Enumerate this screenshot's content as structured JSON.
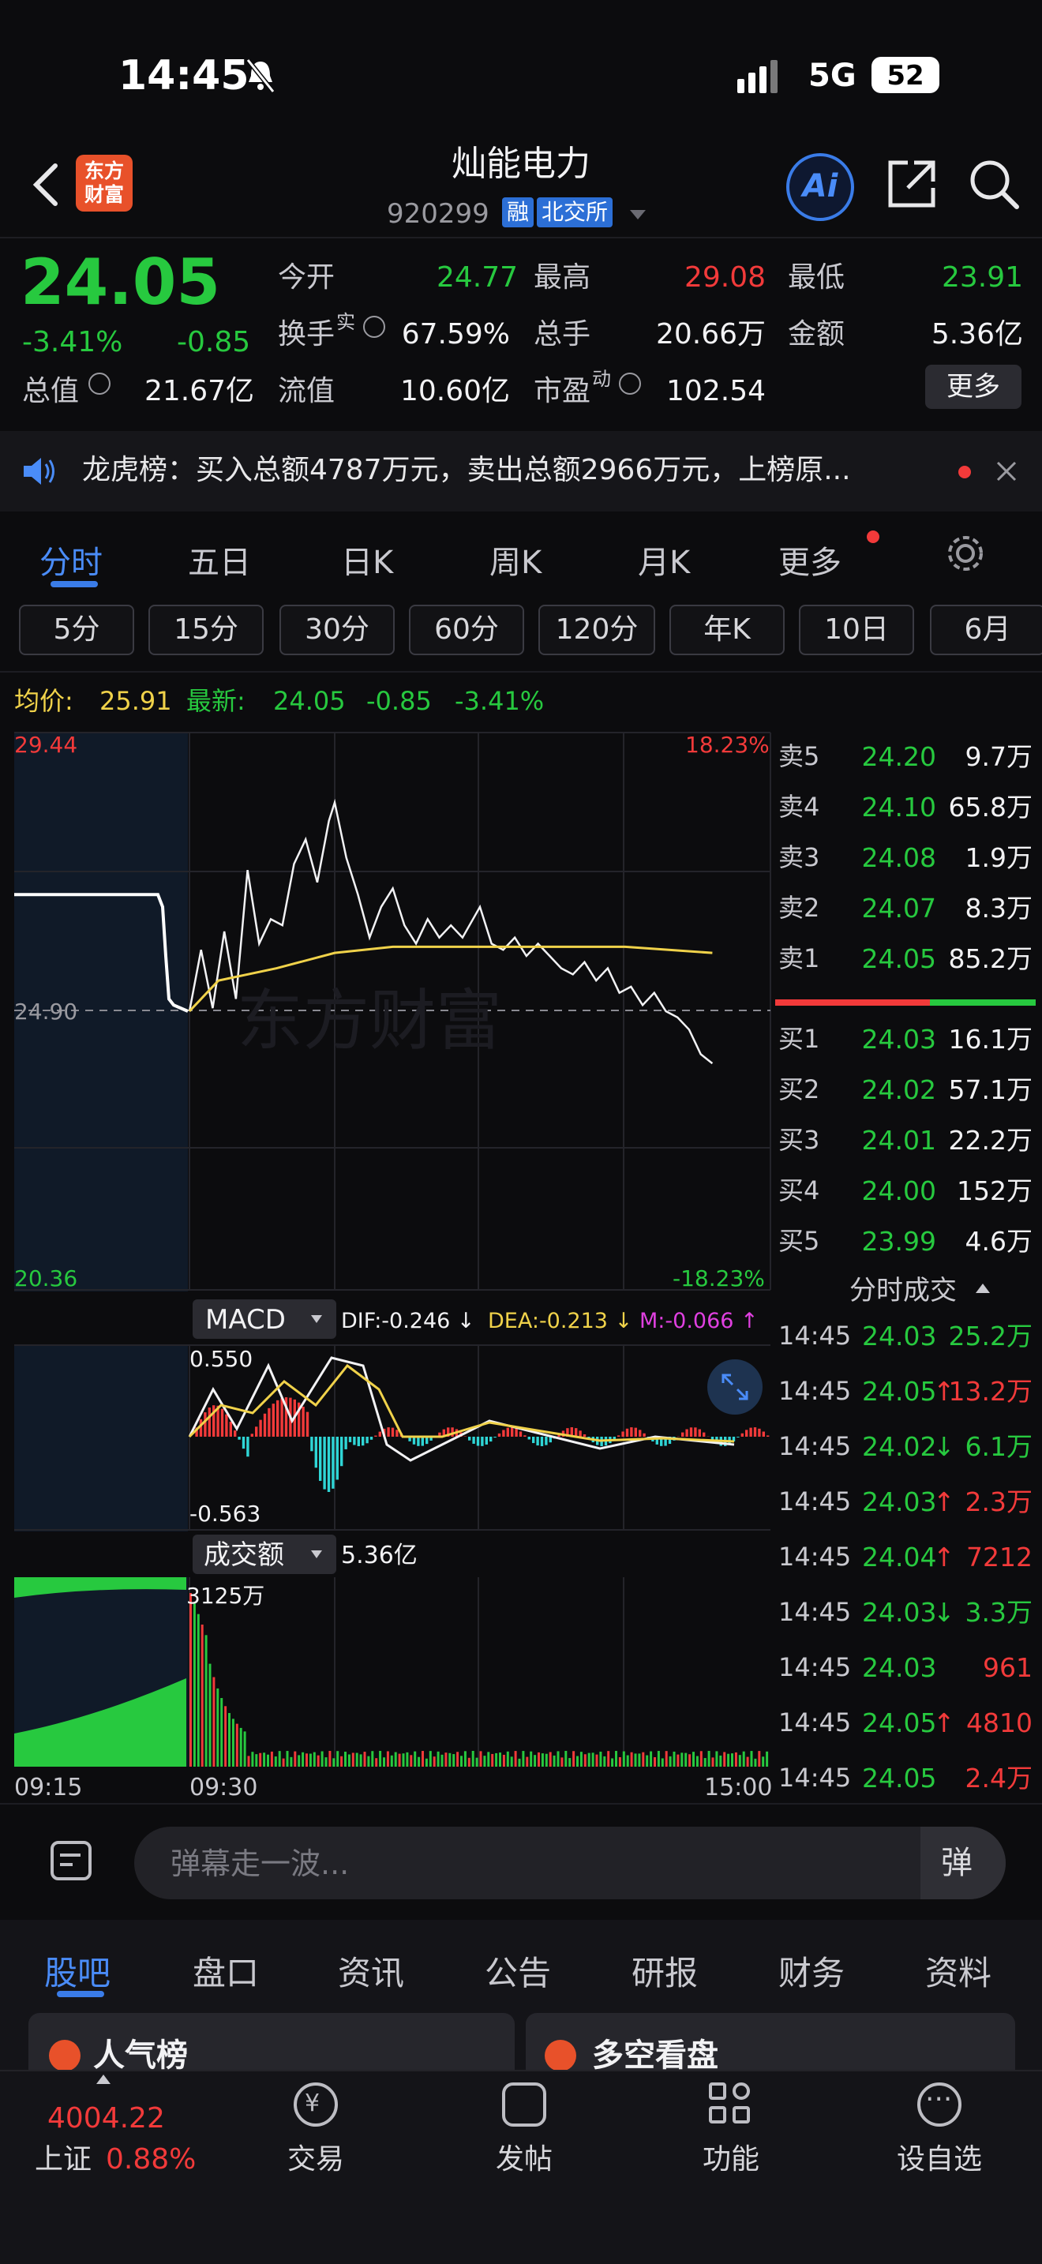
{
  "status": {
    "time": "14:45",
    "network": "5G",
    "battery": "52"
  },
  "header": {
    "title": "灿能电力",
    "code": "920299",
    "tags": [
      "融",
      "北交所"
    ],
    "logo": "东方\n财富",
    "ai_label": "Ai"
  },
  "quote": {
    "price": "24.05",
    "change_pct": "-3.41%",
    "change": "-0.85"
  },
  "stats": {
    "open_label": "今开",
    "open": "24.77",
    "high_label": "最高",
    "high": "29.08",
    "low_label": "最低",
    "low": "23.91",
    "turnover_label": "换手",
    "turnover_sup": "实",
    "turnover": "67.59%",
    "volume_label": "总手",
    "volume": "20.66万",
    "amount_label": "金额",
    "amount": "5.36亿",
    "mktcap_label": "总值",
    "mktcap": "21.67亿",
    "float_label": "流值",
    "float": "10.60亿",
    "pe_label": "市盈",
    "pe_sup": "动",
    "pe": "102.54",
    "more_label": "更多"
  },
  "notice": {
    "text": "龙虎榜：买入总额4787万元，卖出总额2966万元，上榜原..."
  },
  "main_tabs": [
    "分时",
    "五日",
    "日K",
    "周K",
    "月K",
    "更多"
  ],
  "period_buttons": [
    "5分",
    "15分",
    "30分",
    "60分",
    "120分",
    "年K",
    "10日",
    "6月"
  ],
  "info_line": {
    "avg_label": "均价:",
    "avg": "25.91",
    "latest_label": "最新:",
    "latest": "24.05",
    "chg": "-0.85",
    "chg_pct": "-3.41%"
  },
  "intraday": {
    "price_high": "29.44",
    "price_mid": "24.90",
    "price_low": "20.36",
    "pct_high": "18.23%",
    "pct_low": "-18.23%",
    "watermark": "东方财富",
    "prev_close": 24.9,
    "ymax": 29.44,
    "ymin": 20.36
  },
  "order_book": {
    "asks": [
      {
        "label": "卖5",
        "price": "24.20",
        "vol": "9.7万"
      },
      {
        "label": "卖4",
        "price": "24.10",
        "vol": "65.8万"
      },
      {
        "label": "卖3",
        "price": "24.08",
        "vol": "1.9万"
      },
      {
        "label": "卖2",
        "price": "24.07",
        "vol": "8.3万"
      },
      {
        "label": "卖1",
        "price": "24.05",
        "vol": "85.2万"
      }
    ],
    "bids": [
      {
        "label": "买1",
        "price": "24.03",
        "vol": "16.1万"
      },
      {
        "label": "买2",
        "price": "24.02",
        "vol": "57.1万"
      },
      {
        "label": "买3",
        "price": "24.01",
        "vol": "22.2万"
      },
      {
        "label": "买4",
        "price": "24.00",
        "vol": "152万"
      },
      {
        "label": "买5",
        "price": "23.99",
        "vol": "4.6万"
      }
    ]
  },
  "ticks_title": "分时成交",
  "ticks": [
    {
      "time": "14:45",
      "price": "24.03",
      "dir": "",
      "vol": "25.2万",
      "vcolor": "green"
    },
    {
      "time": "14:45",
      "price": "24.05",
      "dir": "↑",
      "vol": "13.2万",
      "vcolor": "red"
    },
    {
      "time": "14:45",
      "price": "24.02",
      "dir": "↓",
      "vol": "6.1万",
      "vcolor": "green"
    },
    {
      "time": "14:45",
      "price": "24.03",
      "dir": "↑",
      "vol": "2.3万",
      "vcolor": "red"
    },
    {
      "time": "14:45",
      "price": "24.04",
      "dir": "↑",
      "vol": "7212",
      "vcolor": "red"
    },
    {
      "time": "14:45",
      "price": "24.03",
      "dir": "↓",
      "vol": "3.3万",
      "vcolor": "green"
    },
    {
      "time": "14:45",
      "price": "24.03",
      "dir": "",
      "vol": "961",
      "vcolor": "red"
    },
    {
      "time": "14:45",
      "price": "24.05",
      "dir": "↑",
      "vol": "4810",
      "vcolor": "red"
    },
    {
      "time": "14:45",
      "price": "24.05",
      "dir": "",
      "vol": "2.4万",
      "vcolor": "red"
    }
  ],
  "macd": {
    "label": "MACD",
    "dif": "DIF:-0.246 ↓",
    "dea": "DEA:-0.213 ↓",
    "m": "M:-0.066 ↑",
    "max": "0.550",
    "min": "-0.563"
  },
  "volume_panel": {
    "label": "成交额",
    "value": "5.36亿",
    "max": "3125万",
    "times": [
      "09:15",
      "09:30",
      "15:00"
    ]
  },
  "comment": {
    "placeholder": "弹幕走一波...",
    "danmu": "弹"
  },
  "bottom_tabs": [
    "股吧",
    "盘口",
    "资讯",
    "公告",
    "研报",
    "财务",
    "资料"
  ],
  "cards": [
    "人气榜",
    "多空看盘"
  ],
  "nav": {
    "index_value": "4004.22",
    "index_name": "上证",
    "index_pct": "0.88%",
    "items": [
      "交易",
      "发帖",
      "功能",
      "设自选"
    ]
  }
}
